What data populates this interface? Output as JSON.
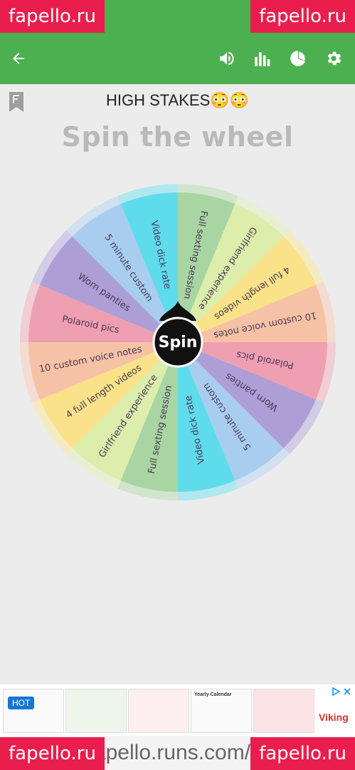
{
  "colors": {
    "primary": "#4caf50",
    "watermark": "#e91e4d"
  },
  "watermark": {
    "text": "fapello.ru"
  },
  "toolbar": {
    "back_icon": "arrow-left-icon",
    "icons": [
      "volume-icon",
      "bar-chart-icon",
      "pie-chart-icon",
      "gear-icon"
    ]
  },
  "page": {
    "title": "HIGH STAKES😳😳",
    "headline": "Spin the wheel"
  },
  "wheel": {
    "button_label": "Spin",
    "segments": [
      {
        "label": "Full sexting session",
        "color": "#a8d5a2"
      },
      {
        "label": "Girlfriend experience",
        "color": "#dcedac"
      },
      {
        "label": "4 full length videos",
        "color": "#f9e289"
      },
      {
        "label": "10 custom voice notes",
        "color": "#f6c2a6"
      },
      {
        "label": "Polaroid pics",
        "color": "#ef9fb2"
      },
      {
        "label": "Worn panties",
        "color": "#ad9ed6"
      },
      {
        "label": "5 minute custom",
        "color": "#a8cdee"
      },
      {
        "label": "Video dick rate",
        "color": "#5fdcec"
      },
      {
        "label": "Full sexting session",
        "color": "#a8d5a2"
      },
      {
        "label": "Girlfriend experience",
        "color": "#dcedac"
      },
      {
        "label": "4 full length videos",
        "color": "#f9e289"
      },
      {
        "label": "10 custom voice notes",
        "color": "#f6c2a6"
      },
      {
        "label": "Polaroid pics",
        "color": "#ef9fb2"
      },
      {
        "label": "Worn panties",
        "color": "#ad9ed6"
      },
      {
        "label": "5 minute custom",
        "color": "#a8cdee"
      },
      {
        "label": "Video dick rate",
        "color": "#5fdcec"
      }
    ]
  },
  "ad": {
    "badge": "HOT",
    "brand": "Viking",
    "calendar_title": "Yearly Calendar"
  },
  "url_strip": {
    "text": "fapello.runs.com/lo"
  }
}
